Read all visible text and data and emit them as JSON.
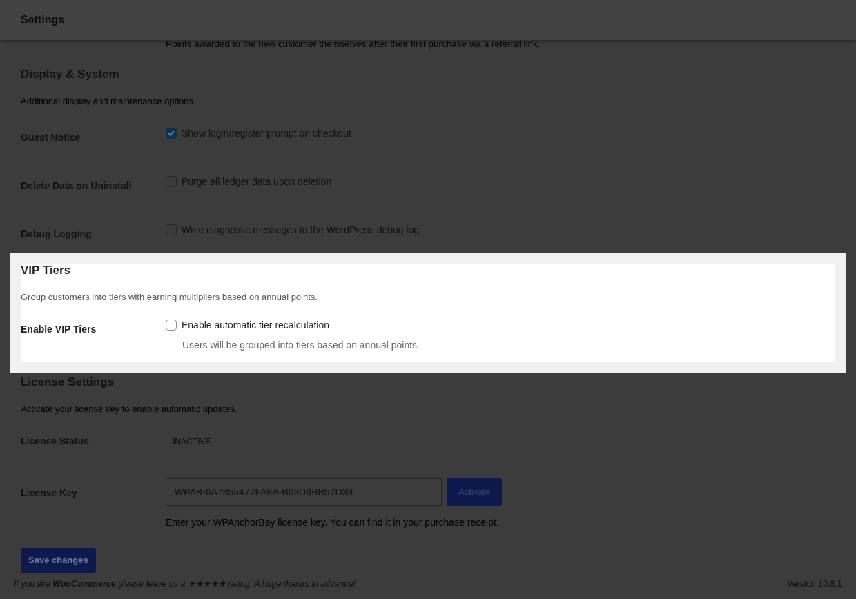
{
  "header": {
    "title": "Settings"
  },
  "top_note": "Points awarded to the new customer themselves after their first purchase via a referral link.",
  "sections": [
    {
      "title": "Display & System",
      "description": "Additional display and maintenance options.",
      "highlighted": false,
      "rows": [
        {
          "kind": "checkbox",
          "label": "Guest Notice",
          "text": "Show login/register prompt on checkout",
          "checked": true
        },
        {
          "kind": "checkbox",
          "label": "Delete Data on Uninstall",
          "text": "Purge all ledger data upon deletion",
          "checked": false
        },
        {
          "kind": "checkbox",
          "label": "Debug Logging",
          "text": "Write diagnostic messages to the WordPress debug log",
          "checked": false
        }
      ]
    },
    {
      "title": "VIP Tiers",
      "description": "Group customers into tiers with earning multipliers based on annual points.",
      "highlighted": true,
      "rows": [
        {
          "kind": "checkbox",
          "label": "Enable VIP Tiers",
          "text": "Enable automatic tier recalculation",
          "checked": false,
          "help": "Users will be grouped into tiers based on annual points."
        }
      ]
    },
    {
      "title": "License Settings",
      "description": "Activate your license key to enable automatic updates.",
      "highlighted": false,
      "rows": [
        {
          "kind": "status",
          "label": "License Status",
          "value": "INACTIVE"
        },
        {
          "kind": "key",
          "label": "License Key",
          "value": "WPAB-6A7855477FA8A-B63D9BB57D33",
          "button": "Activate",
          "help": "Enter your WPAnchorBay license key. You can find it in your purchase receipt."
        }
      ]
    }
  ],
  "save_button": "Save changes",
  "footer": {
    "text": "If you like **WooCommerce** please leave us a ★★★★★ rating. A huge thanks in advance!",
    "version": "Version 10.8.1"
  }
}
